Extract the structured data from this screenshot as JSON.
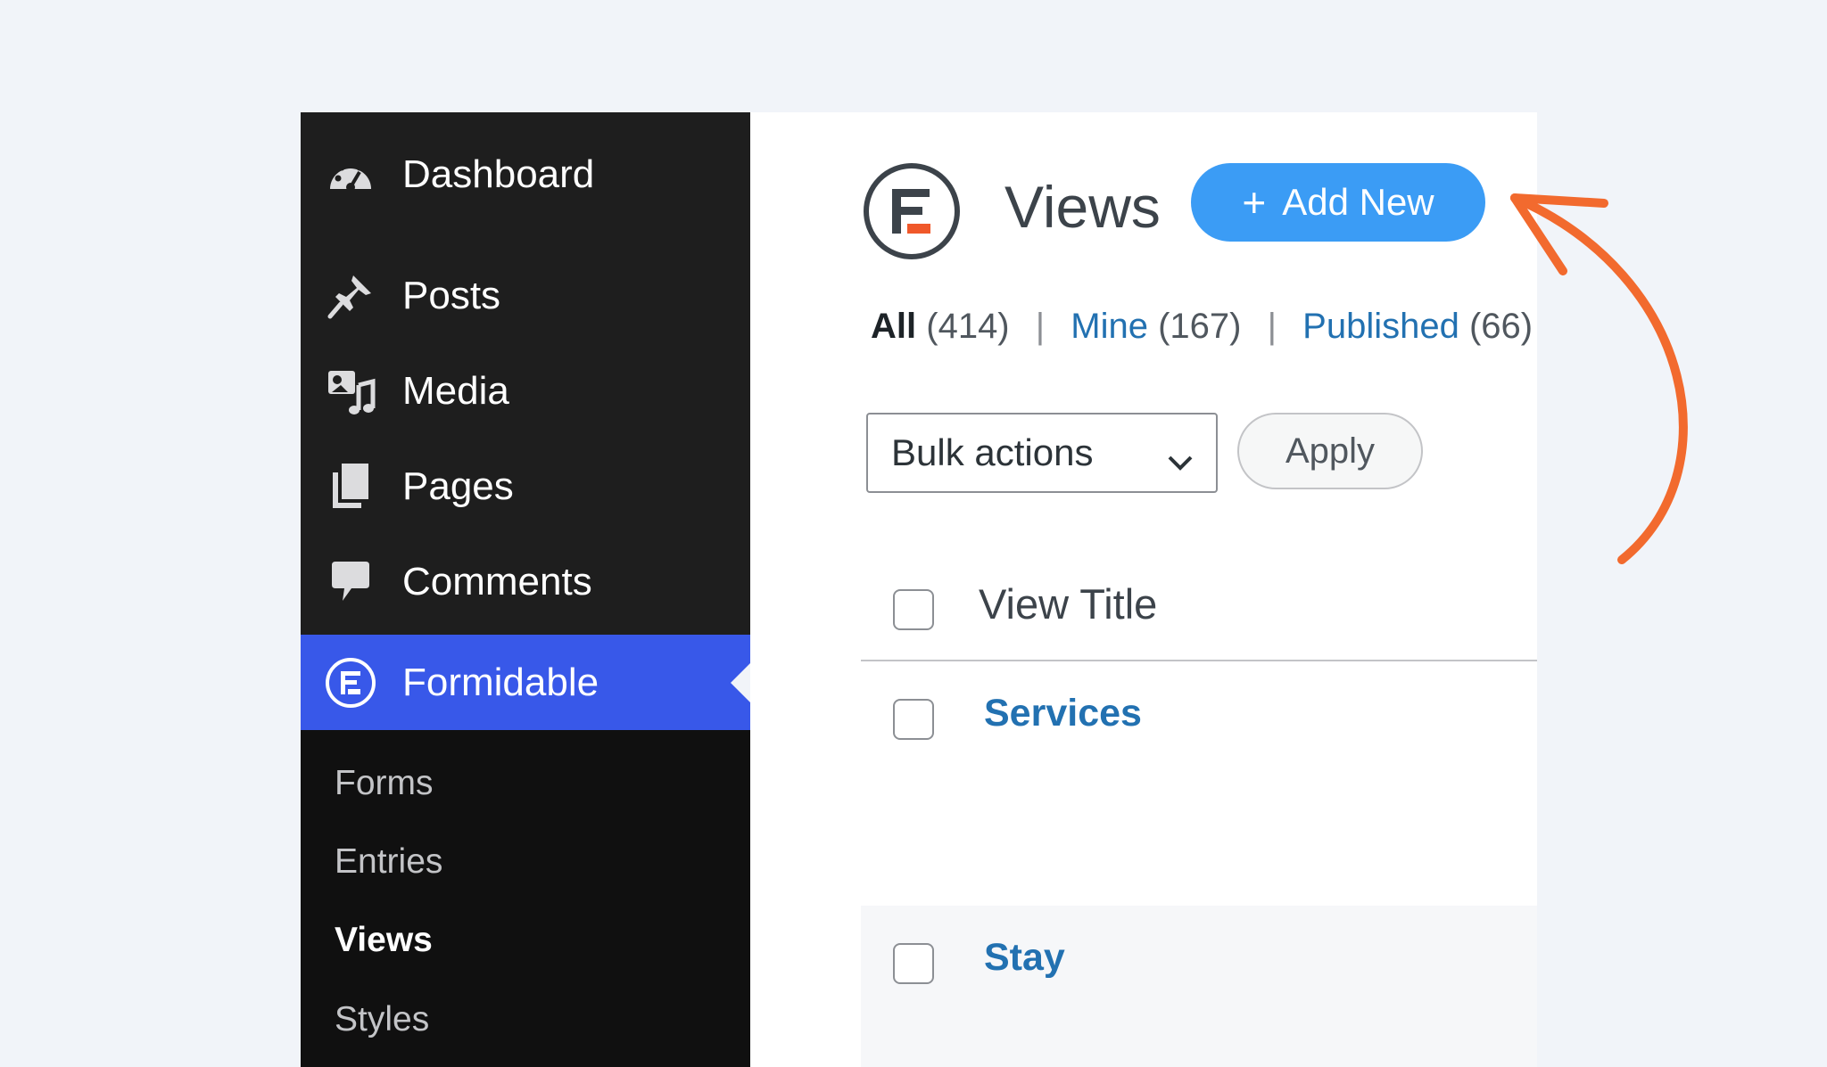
{
  "sidebar": {
    "items": [
      {
        "label": "Dashboard",
        "icon": "dashboard-icon"
      },
      {
        "label": "Posts",
        "icon": "pin-icon"
      },
      {
        "label": "Media",
        "icon": "media-icon"
      },
      {
        "label": "Pages",
        "icon": "pages-icon"
      },
      {
        "label": "Comments",
        "icon": "comments-icon"
      },
      {
        "label": "Formidable",
        "icon": "formidable-icon",
        "active": true
      }
    ],
    "submenu": [
      {
        "label": "Forms"
      },
      {
        "label": "Entries"
      },
      {
        "label": "Views",
        "current": true
      },
      {
        "label": "Styles"
      }
    ]
  },
  "header": {
    "title": "Views",
    "add_new_plus": "+",
    "add_new_label": "Add New"
  },
  "filters": {
    "all_label": "All",
    "all_count": "(414)",
    "mine_label": "Mine",
    "mine_count": "(167)",
    "published_label": "Published",
    "published_count": "(66)",
    "separator": "|"
  },
  "bulk": {
    "selected": "Bulk actions",
    "apply_label": "Apply"
  },
  "table": {
    "column_title": "View Title",
    "rows": [
      {
        "title": "Services"
      },
      {
        "title": "Stay"
      }
    ]
  },
  "colors": {
    "sidebar_bg": "#1e1e1e",
    "active_item": "#3858e9",
    "add_new_button": "#3b9cf5",
    "link": "#2271b1",
    "arrow": "#f26a2e"
  }
}
